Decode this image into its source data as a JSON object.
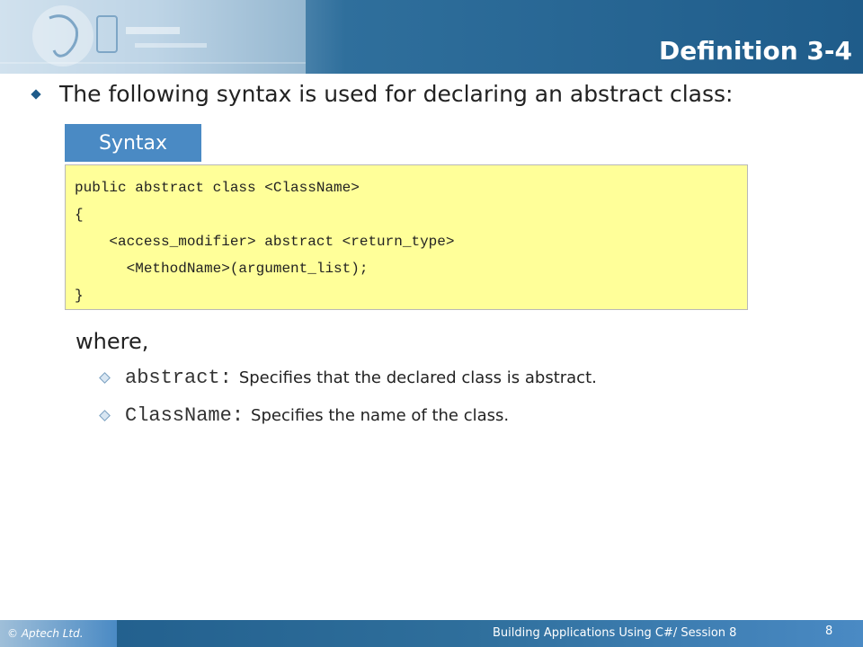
{
  "header": {
    "title": "Definition 3-4"
  },
  "intro": {
    "text": "The following syntax is used for declaring an abstract class:"
  },
  "syntax": {
    "tab_label": "Syntax",
    "lines": [
      "public abstract class <ClassName>",
      "{",
      "    <access_modifier> abstract <return_type>",
      "      <MethodName>(argument_list);",
      "}"
    ]
  },
  "where": {
    "label": "where,"
  },
  "definitions": [
    {
      "term": "abstract:",
      "description": "Specifies that the declared class is abstract."
    },
    {
      "term": "ClassName:",
      "description": "Specifies the name of the class."
    }
  ],
  "footer": {
    "copyright": "© Aptech Ltd.",
    "course": "Building Applications Using C#/ Session 8",
    "page": "8"
  },
  "colors": {
    "header_blue": "#1f5c8a",
    "syntax_tab": "#4a8ac4",
    "code_background": "#ffff99"
  }
}
